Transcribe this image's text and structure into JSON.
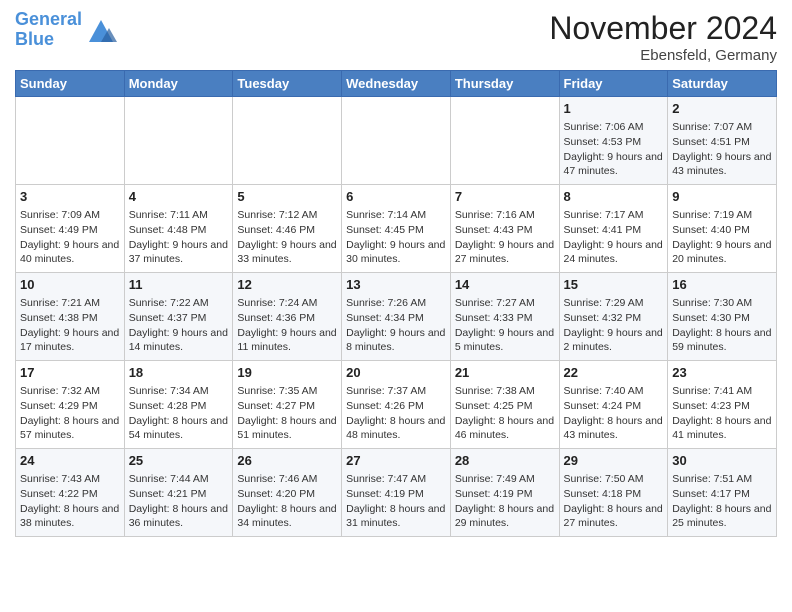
{
  "header": {
    "logo_text_general": "General",
    "logo_text_blue": "Blue",
    "month_year": "November 2024",
    "location": "Ebensfeld, Germany"
  },
  "days_of_week": [
    "Sunday",
    "Monday",
    "Tuesday",
    "Wednesday",
    "Thursday",
    "Friday",
    "Saturday"
  ],
  "weeks": [
    [
      {
        "day": "",
        "info": ""
      },
      {
        "day": "",
        "info": ""
      },
      {
        "day": "",
        "info": ""
      },
      {
        "day": "",
        "info": ""
      },
      {
        "day": "",
        "info": ""
      },
      {
        "day": "1",
        "info": "Sunrise: 7:06 AM\nSunset: 4:53 PM\nDaylight: 9 hours and 47 minutes."
      },
      {
        "day": "2",
        "info": "Sunrise: 7:07 AM\nSunset: 4:51 PM\nDaylight: 9 hours and 43 minutes."
      }
    ],
    [
      {
        "day": "3",
        "info": "Sunrise: 7:09 AM\nSunset: 4:49 PM\nDaylight: 9 hours and 40 minutes."
      },
      {
        "day": "4",
        "info": "Sunrise: 7:11 AM\nSunset: 4:48 PM\nDaylight: 9 hours and 37 minutes."
      },
      {
        "day": "5",
        "info": "Sunrise: 7:12 AM\nSunset: 4:46 PM\nDaylight: 9 hours and 33 minutes."
      },
      {
        "day": "6",
        "info": "Sunrise: 7:14 AM\nSunset: 4:45 PM\nDaylight: 9 hours and 30 minutes."
      },
      {
        "day": "7",
        "info": "Sunrise: 7:16 AM\nSunset: 4:43 PM\nDaylight: 9 hours and 27 minutes."
      },
      {
        "day": "8",
        "info": "Sunrise: 7:17 AM\nSunset: 4:41 PM\nDaylight: 9 hours and 24 minutes."
      },
      {
        "day": "9",
        "info": "Sunrise: 7:19 AM\nSunset: 4:40 PM\nDaylight: 9 hours and 20 minutes."
      }
    ],
    [
      {
        "day": "10",
        "info": "Sunrise: 7:21 AM\nSunset: 4:38 PM\nDaylight: 9 hours and 17 minutes."
      },
      {
        "day": "11",
        "info": "Sunrise: 7:22 AM\nSunset: 4:37 PM\nDaylight: 9 hours and 14 minutes."
      },
      {
        "day": "12",
        "info": "Sunrise: 7:24 AM\nSunset: 4:36 PM\nDaylight: 9 hours and 11 minutes."
      },
      {
        "day": "13",
        "info": "Sunrise: 7:26 AM\nSunset: 4:34 PM\nDaylight: 9 hours and 8 minutes."
      },
      {
        "day": "14",
        "info": "Sunrise: 7:27 AM\nSunset: 4:33 PM\nDaylight: 9 hours and 5 minutes."
      },
      {
        "day": "15",
        "info": "Sunrise: 7:29 AM\nSunset: 4:32 PM\nDaylight: 9 hours and 2 minutes."
      },
      {
        "day": "16",
        "info": "Sunrise: 7:30 AM\nSunset: 4:30 PM\nDaylight: 8 hours and 59 minutes."
      }
    ],
    [
      {
        "day": "17",
        "info": "Sunrise: 7:32 AM\nSunset: 4:29 PM\nDaylight: 8 hours and 57 minutes."
      },
      {
        "day": "18",
        "info": "Sunrise: 7:34 AM\nSunset: 4:28 PM\nDaylight: 8 hours and 54 minutes."
      },
      {
        "day": "19",
        "info": "Sunrise: 7:35 AM\nSunset: 4:27 PM\nDaylight: 8 hours and 51 minutes."
      },
      {
        "day": "20",
        "info": "Sunrise: 7:37 AM\nSunset: 4:26 PM\nDaylight: 8 hours and 48 minutes."
      },
      {
        "day": "21",
        "info": "Sunrise: 7:38 AM\nSunset: 4:25 PM\nDaylight: 8 hours and 46 minutes."
      },
      {
        "day": "22",
        "info": "Sunrise: 7:40 AM\nSunset: 4:24 PM\nDaylight: 8 hours and 43 minutes."
      },
      {
        "day": "23",
        "info": "Sunrise: 7:41 AM\nSunset: 4:23 PM\nDaylight: 8 hours and 41 minutes."
      }
    ],
    [
      {
        "day": "24",
        "info": "Sunrise: 7:43 AM\nSunset: 4:22 PM\nDaylight: 8 hours and 38 minutes."
      },
      {
        "day": "25",
        "info": "Sunrise: 7:44 AM\nSunset: 4:21 PM\nDaylight: 8 hours and 36 minutes."
      },
      {
        "day": "26",
        "info": "Sunrise: 7:46 AM\nSunset: 4:20 PM\nDaylight: 8 hours and 34 minutes."
      },
      {
        "day": "27",
        "info": "Sunrise: 7:47 AM\nSunset: 4:19 PM\nDaylight: 8 hours and 31 minutes."
      },
      {
        "day": "28",
        "info": "Sunrise: 7:49 AM\nSunset: 4:19 PM\nDaylight: 8 hours and 29 minutes."
      },
      {
        "day": "29",
        "info": "Sunrise: 7:50 AM\nSunset: 4:18 PM\nDaylight: 8 hours and 27 minutes."
      },
      {
        "day": "30",
        "info": "Sunrise: 7:51 AM\nSunset: 4:17 PM\nDaylight: 8 hours and 25 minutes."
      }
    ]
  ]
}
